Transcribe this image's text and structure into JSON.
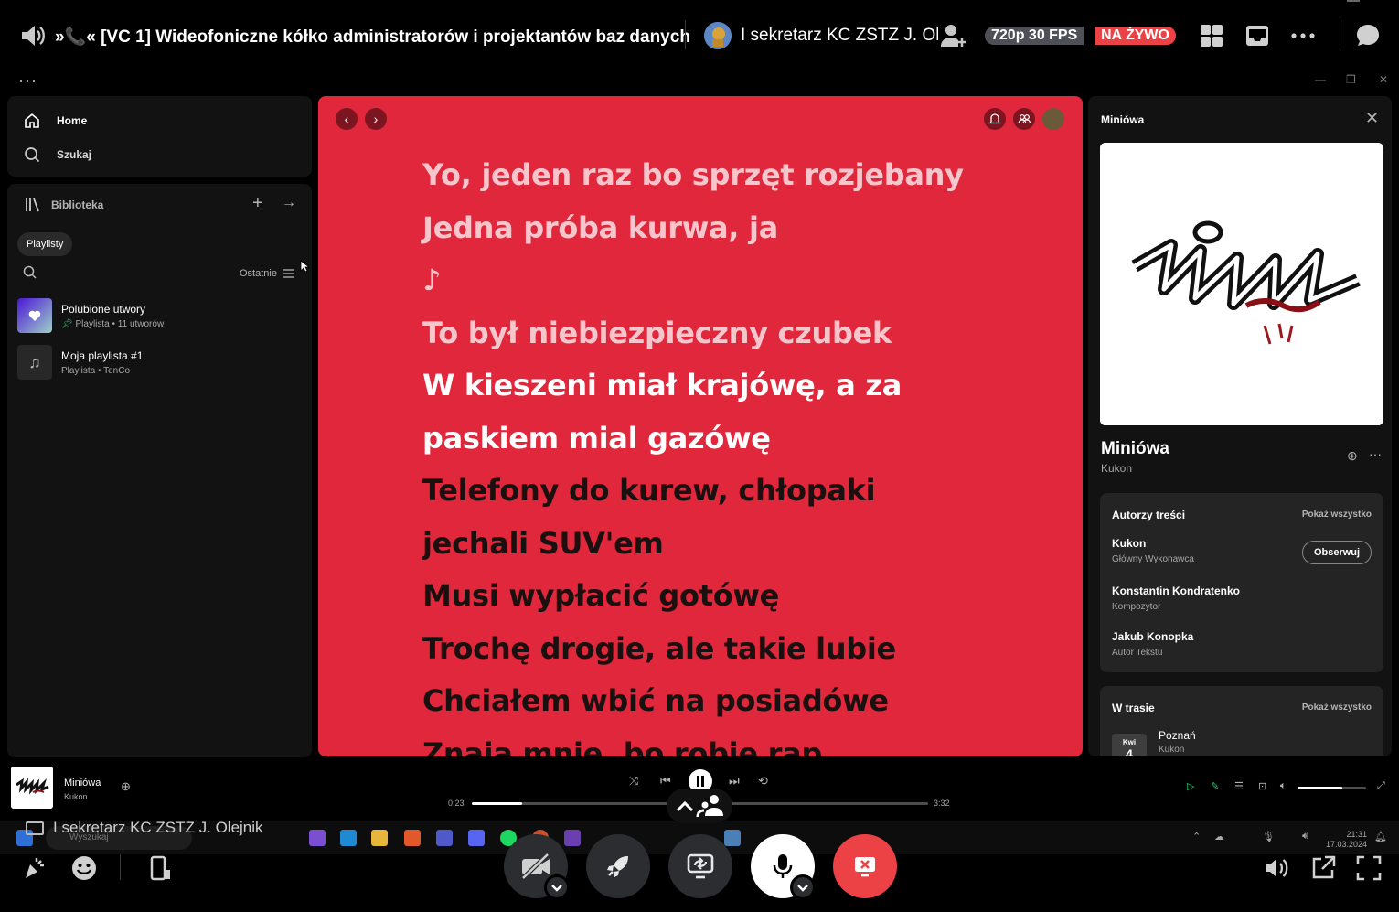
{
  "discord": {
    "channel_title": "»📞« [VC 1] Wideofoniczne kółko administratorów i projektantów baz danych",
    "streamer_name": "I sekretarz KC ZSTZ J. Olejnik",
    "quality_badge": "720p 30 FPS",
    "live_badge": "NA ŻYWO",
    "colors": {
      "live": "#ed4245",
      "badge": "#4e5058",
      "hangup": "#ed4245"
    }
  },
  "spotify": {
    "nav": {
      "home": "Home",
      "search": "Szukaj"
    },
    "library": {
      "title": "Biblioteka",
      "filter_chip": "Playlisty",
      "sort_label": "Ostatnie",
      "items": [
        {
          "title": "Polubione utwory",
          "subtitle": "Playlista • 11 utworów"
        },
        {
          "title": "Moja playlista #1",
          "subtitle": "Playlista • TenCo"
        }
      ]
    },
    "lyrics": {
      "past": [
        "Yo, jeden raz bo sprzęt rozjebany",
        "Jedna próba kurwa, ja",
        "♪",
        "To był niebiezpieczny czubek"
      ],
      "current": [
        "W kieszeni miał krajówę, a za",
        "paskiem mial gazówę"
      ],
      "upcoming": [
        "Telefony do kurew, chłopaki",
        "jechali SUV'em",
        "Musi wypłacić gotówę",
        "Trochę drogie, ale takie lubie",
        "Chciałem wbić na posiadówe",
        "Znaja mnie, bo robie rap"
      ],
      "background": "#e0273b"
    },
    "now_playing_panel": {
      "header": "Miniówa",
      "song": "Miniówa",
      "artist": "Kukon",
      "credits_title": "Autorzy treści",
      "show_all": "Pokaż wszystko",
      "follow_label": "Obserwuj",
      "credits": [
        {
          "name": "Kukon",
          "role": "Główny Wykonawca"
        },
        {
          "name": "Konstantin Kondratenko",
          "role": "Kompozytor"
        },
        {
          "name": "Jakub Konopka",
          "role": "Autor Tekstu"
        }
      ],
      "tour_title": "W trasie",
      "tour_show_all": "Pokaż wszystko",
      "tour_month": "Kwi",
      "tour_day": "4",
      "tour_city": "Poznań",
      "tour_artist": "Kukon"
    },
    "player": {
      "song": "Miniówa",
      "artist": "Kukon",
      "time_current": "0:23",
      "time_total": "3:32",
      "progress": 0.11,
      "volume": 0.65
    }
  },
  "taskbar": {
    "search_placeholder": "Wyszukaj",
    "time": "21:31",
    "date": "17.03.2024"
  },
  "stream_overlay_name": "I sekretarz KC ZSTZ J. Olejnik"
}
